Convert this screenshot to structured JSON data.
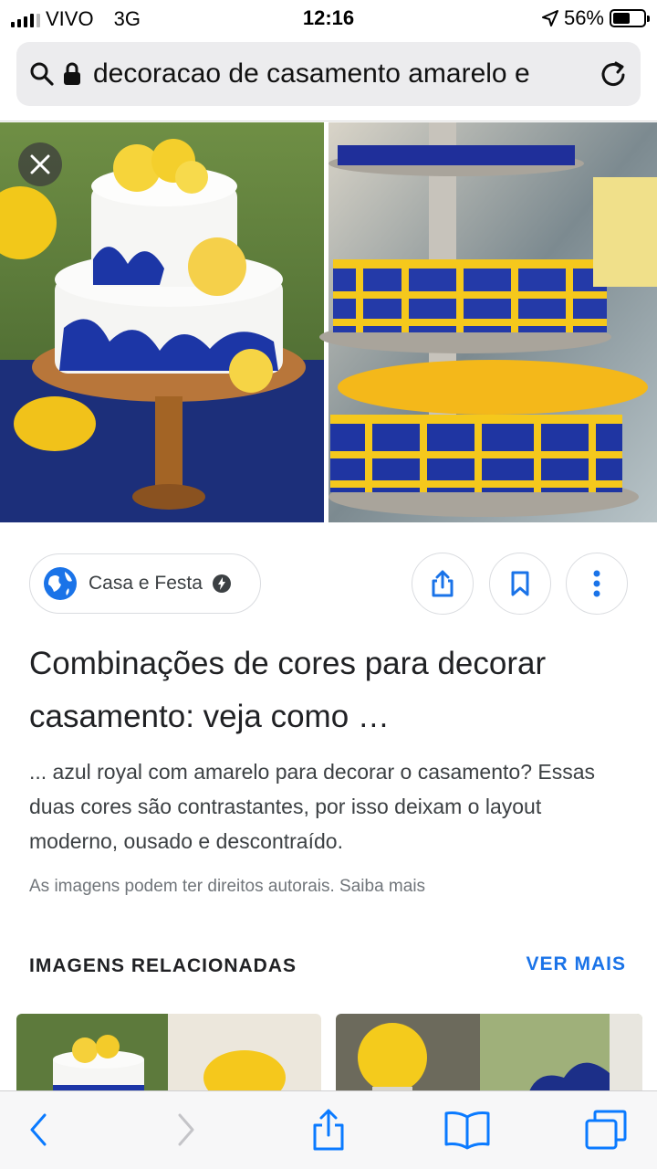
{
  "status_bar": {
    "carrier": "VIVO",
    "network": "3G",
    "time": "12:16",
    "battery": "56%",
    "battery_level": 0.56
  },
  "url_bar": {
    "url_text": "decoracao de casamento amarelo e"
  },
  "result": {
    "source_name": "Casa e Festa",
    "title": "Combinações de cores para decorar casamento: veja como …",
    "snippet": "... azul royal com amarelo para decorar o casamento? Essas duas cores são contrastantes, por isso deixam o layout moderno, ousado e descontraído.",
    "copyright_notice": "As imagens podem ter direitos autorais. Saiba mais"
  },
  "related": {
    "heading": "IMAGENS RELACIONADAS",
    "see_more": "VER MAIS"
  },
  "colors": {
    "accent_blue": "#1a73e8",
    "royal_blue": "#1f3a9a",
    "yellow": "#f5c518",
    "chip_border": "#dadce0",
    "toolbar_blue": "#0a7aff"
  }
}
